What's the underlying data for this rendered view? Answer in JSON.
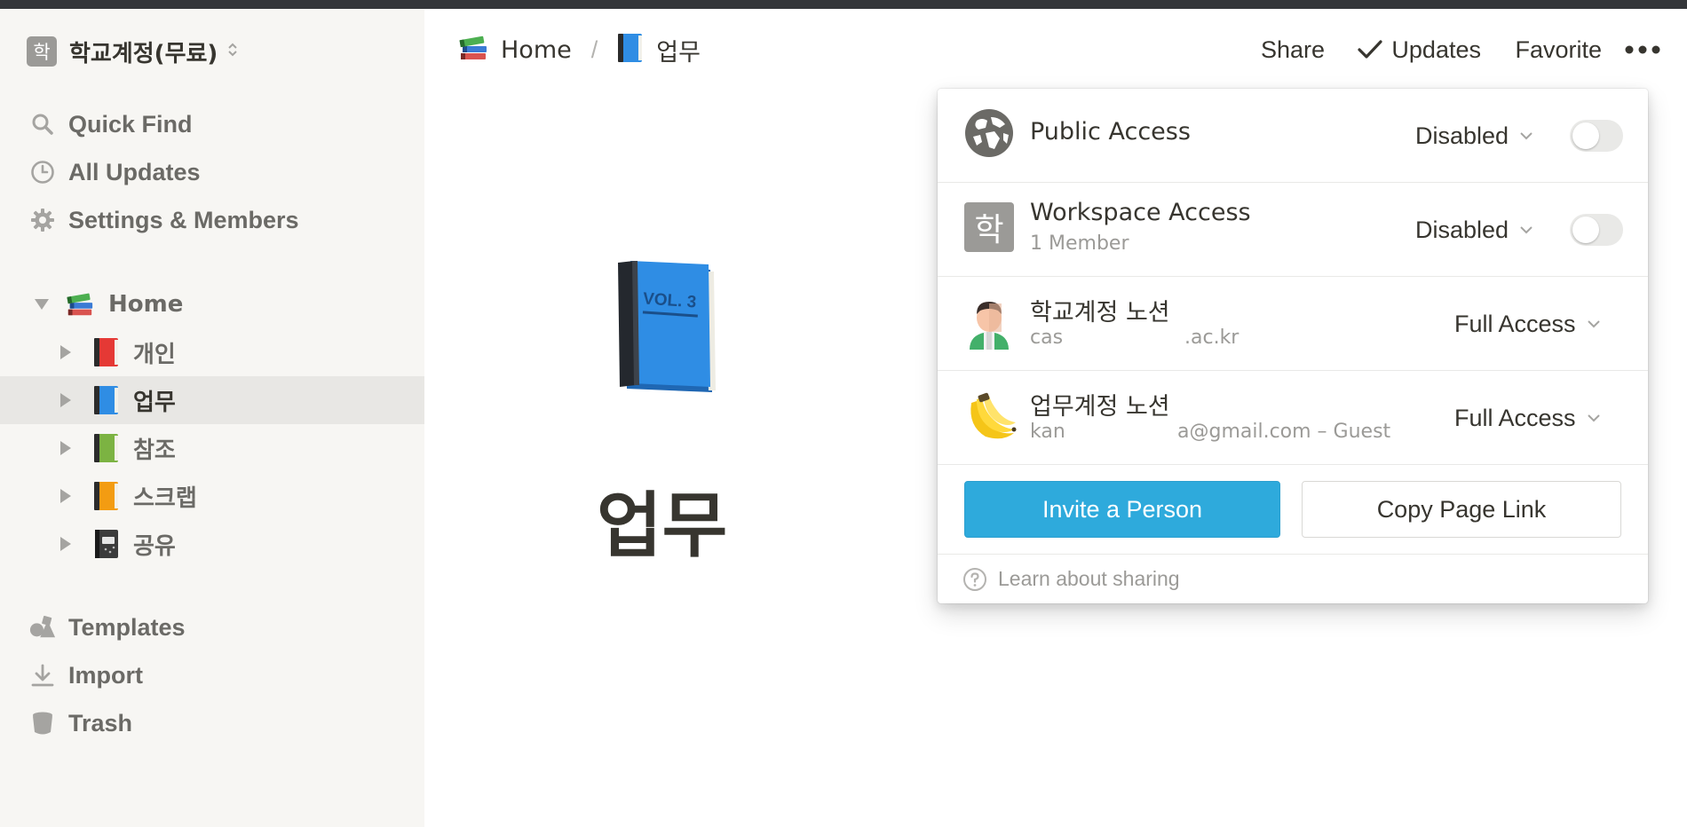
{
  "workspace": {
    "avatar_letter": "학",
    "name": "학교계정(무료)",
    "switch_icon": "chevron-updown-icon"
  },
  "sidebar": {
    "nav": [
      {
        "label": "Quick Find",
        "icon": "search-icon"
      },
      {
        "label": "All Updates",
        "icon": "clock-icon"
      },
      {
        "label": "Settings & Members",
        "icon": "gear-icon"
      }
    ],
    "tree": [
      {
        "label": "Home",
        "emoji": "books-icon",
        "expanded": true
      },
      {
        "label": "개인",
        "emoji": "red-book-icon"
      },
      {
        "label": "업무",
        "emoji": "blue-book-icon",
        "selected": true
      },
      {
        "label": "참조",
        "emoji": "green-book-icon"
      },
      {
        "label": "스크랩",
        "emoji": "orange-book-icon"
      },
      {
        "label": "공유",
        "emoji": "notebook-icon"
      }
    ],
    "bottom": [
      {
        "label": "Templates",
        "icon": "shapes-icon"
      },
      {
        "label": "Import",
        "icon": "download-icon"
      },
      {
        "label": "Trash",
        "icon": "trash-icon"
      }
    ]
  },
  "header": {
    "breadcrumb": [
      {
        "label": "Home",
        "emoji": "books-icon"
      },
      {
        "label": "업무",
        "emoji": "blue-book-icon"
      }
    ],
    "breadcrumb_sep": "/",
    "share_label": "Share",
    "updates_label": "Updates",
    "favorite_label": "Favorite",
    "more_icon": "more-dots-icon"
  },
  "page": {
    "icon": "blue-book-icon",
    "icon_text": "VOL. 3",
    "title": "업무"
  },
  "share_popup": {
    "public_access": {
      "title": "Public Access",
      "value": "Disabled",
      "enabled": false
    },
    "workspace_access": {
      "avatar_letter": "학",
      "title": "Workspace Access",
      "subtitle": "1 Member",
      "value": "Disabled",
      "enabled": false
    },
    "members": [
      {
        "name": "학교계정 노션",
        "email": "cas .ac.kr",
        "email_visible_start": "cas",
        "email_visible_end": ".ac.kr",
        "access": "Full Access",
        "avatar": "person-avatar-icon"
      },
      {
        "name": "업무계정 노션",
        "email": "kan a@gmail.com – Guest",
        "email_visible_start": "kan",
        "email_visible_end": "a@gmail.com – Guest",
        "access": "Full Access",
        "avatar": "banana-icon"
      }
    ],
    "invite_label": "Invite a Person",
    "copy_link_label": "Copy Page Link",
    "learn_label": "Learn about sharing"
  },
  "colors": {
    "accent": "#2eaadc",
    "sidebar_bg": "#f7f6f3",
    "selected_bg": "#e8e7e4",
    "text": "#37352f",
    "muted": "#9b9a97"
  }
}
